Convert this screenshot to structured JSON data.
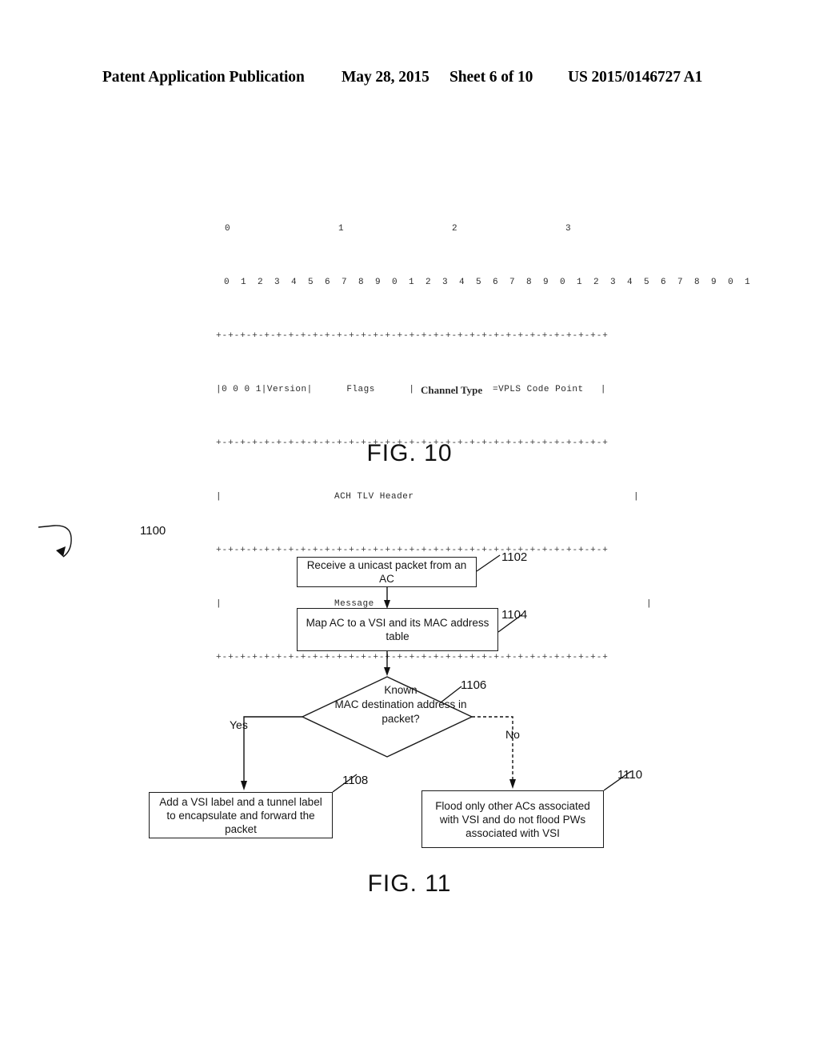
{
  "header": {
    "left": "Patent Application Publication",
    "date": "May 28, 2015",
    "sheet": "Sheet 6 of 10",
    "patent_number": "US 2015/0146727 A1"
  },
  "figures": {
    "fig10": {
      "caption": "FIG. 10",
      "type": "ascii-packet-header-diagram",
      "word_ruler": [
        "0",
        "1",
        "2",
        "3"
      ],
      "bit_ruler": "0 1 2 3 4 5 6 7 8 9 0 1 2 3 4 5 6 7 8 9 0 1 2 3 4 5 6 7 8 9 0 1",
      "separator": "+-+-+-+-+-+-+-+-+-+-+-+-+-+-+-+-+-+-+-+-+-+-+-+-+-+-+-+-+-+-+-+-+",
      "rows": [
        {
          "fields_plain_left": "|0 0 0 1|Version|      Flags      |  ",
          "fields_bold": "Channel Type",
          "fields_plain_right": "=VPLS Code Point   |"
        },
        {
          "label": "ACH TLV Header"
        },
        {
          "label": "Message"
        }
      ]
    },
    "fig11": {
      "caption": "FIG. 11",
      "diagram_ref": "1100",
      "nodes": [
        {
          "ref": "1102",
          "shape": "process",
          "text": "Receive a unicast packet from an AC"
        },
        {
          "ref": "1104",
          "shape": "process",
          "text": "Map AC to a VSI and its MAC address table"
        },
        {
          "ref": "1106",
          "shape": "decision",
          "line1": "Known",
          "line2": "MAC destination address in",
          "line3": "packet?"
        },
        {
          "ref": "1108",
          "shape": "process",
          "text": "Add a VSI label and a tunnel label to encapsulate and forward the packet"
        },
        {
          "ref": "1110",
          "shape": "process",
          "text": "Flood only other ACs associated with VSI and do not flood PWs associated with VSI"
        }
      ],
      "branches": {
        "yes": "Yes",
        "no": "No"
      }
    }
  }
}
